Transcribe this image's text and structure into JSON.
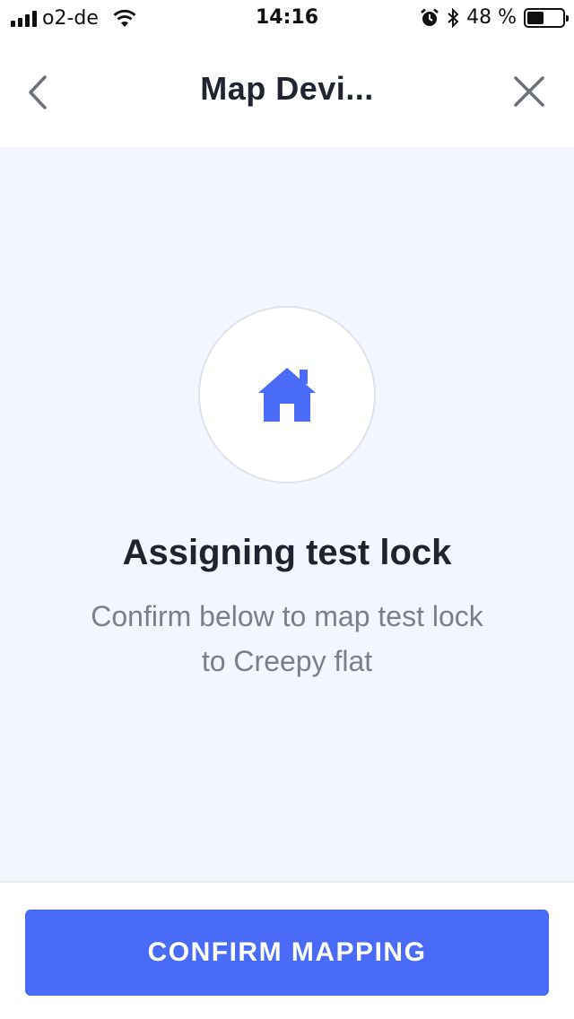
{
  "status_bar": {
    "carrier": "o2-de",
    "time": "14:16",
    "battery_percent": "48 %",
    "battery_level": 0.48,
    "icons": [
      "signal-icon",
      "wifi-icon",
      "alarm-icon",
      "bluetooth-icon",
      "battery-icon"
    ]
  },
  "nav": {
    "title": "Map Devi...",
    "back_icon": "chevron-left-icon",
    "close_icon": "close-icon"
  },
  "main": {
    "icon": "home-icon",
    "headline": "Assigning test lock",
    "description": "Confirm below to map test lock to Creepy flat"
  },
  "footer": {
    "confirm_label": "CONFIRM MAPPING"
  },
  "colors": {
    "accent": "#4a6bf7",
    "background": "#f3f6fe",
    "text_primary": "#1f2430",
    "text_secondary": "#7a7f8c"
  }
}
